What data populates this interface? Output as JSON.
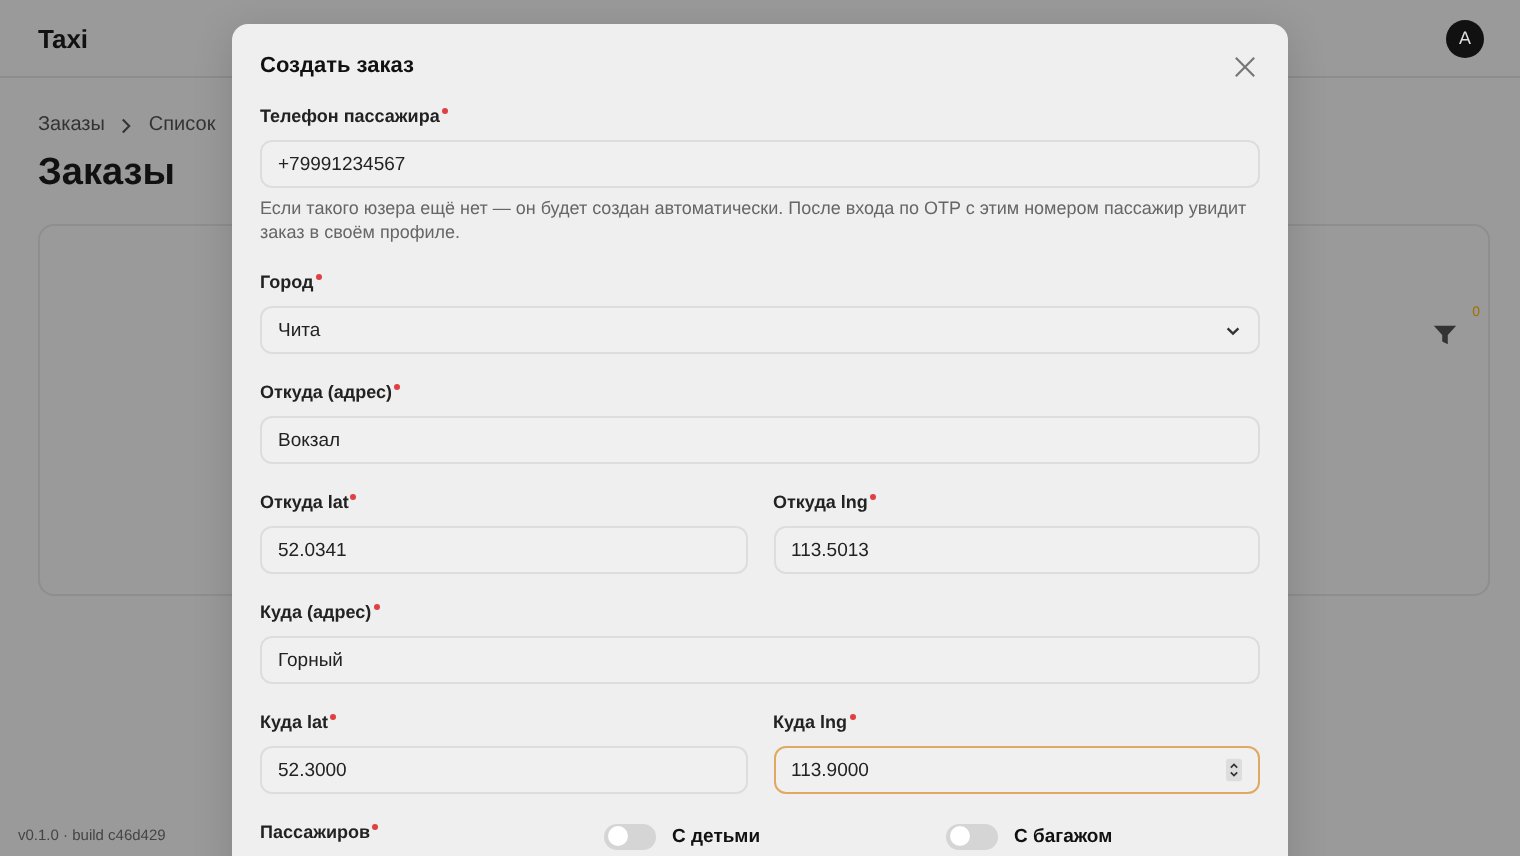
{
  "app": {
    "logo": "Taxi",
    "avatar": "A",
    "breadcrumbs": [
      "Заказы",
      "Список"
    ],
    "page_title": "Заказы",
    "filter_badge": "0",
    "version": "v0.1.0 · build c46d429"
  },
  "modal": {
    "title": "Создать заказ",
    "rows": [
      {
        "fields": [
          {
            "kind": "text",
            "label": "Телефон пассажира",
            "required": true,
            "value": "+79991234567",
            "focused": false,
            "hint": "Если такого юзера ещё нет — он будет создан автоматически. После входа по OTP с этим номером пассажир увидит заказ в своём профиле."
          }
        ]
      },
      {
        "fields": [
          {
            "kind": "select",
            "label": "Город",
            "required": true,
            "value": "Чита",
            "focused": false
          }
        ]
      },
      {
        "fields": [
          {
            "kind": "text",
            "label": "Откуда (адрес)",
            "required": true,
            "value": "Вокзал",
            "focused": false
          }
        ]
      },
      {
        "fields": [
          {
            "kind": "text",
            "label": "Откуда lat",
            "required": true,
            "value": "52.0341",
            "focused": false
          },
          {
            "kind": "text",
            "label": "Откуда lng",
            "required": true,
            "value": "113.5013",
            "focused": false
          }
        ]
      },
      {
        "fields": [
          {
            "kind": "text",
            "label": "Куда (адрес)",
            "required": true,
            "value": "Горный",
            "focused": false
          }
        ]
      },
      {
        "fields": [
          {
            "kind": "text",
            "label": "Куда lat",
            "required": true,
            "value": "52.3000",
            "focused": false
          },
          {
            "kind": "number",
            "label": "Куда lng",
            "required": true,
            "value": "113.9000",
            "focused": true
          }
        ]
      },
      {
        "fields": [
          {
            "kind": "text",
            "label": "Пассажиров",
            "required": true
          },
          {
            "kind": "toggle",
            "label": "С детьми",
            "on": false
          },
          {
            "kind": "toggle",
            "label": "С багажом",
            "on": false
          }
        ]
      }
    ]
  }
}
